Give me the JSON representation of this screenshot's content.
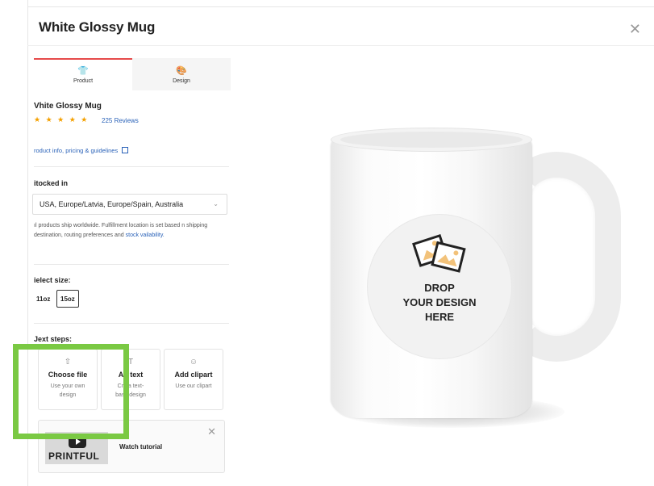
{
  "window": {
    "title": "White Glossy Mug"
  },
  "tabs": [
    {
      "label": "Product",
      "icon": "shirt-icon"
    },
    {
      "label": "Design",
      "icon": "palette-icon"
    }
  ],
  "product": {
    "name": "Vhite Glossy Mug",
    "stars": "★ ★ ★ ★ ★",
    "rating": 5,
    "reviews": "225 Reviews",
    "info_link": "roduct info, pricing & guidelines"
  },
  "stocked": {
    "label": "itocked in",
    "value": "USA, Europe/Latvia, Europe/Spain, Australia",
    "ship_text_prefix": "ıl products ship worldwide. Fulfillment location is set based n shipping destination, routing preferences and ",
    "ship_link": "stock vailability."
  },
  "size": {
    "label": "ielect size:",
    "options": [
      "11oz",
      "15oz"
    ],
    "selected": "15oz"
  },
  "next_steps": {
    "label": "Jext steps:",
    "cards": [
      {
        "icon": "upload-icon",
        "title": "Choose file",
        "subtitle": "Use your own design"
      },
      {
        "icon": "text-icon",
        "title": "Ad   text",
        "subtitle": "Cre  a text-\nbase  design"
      },
      {
        "icon": "smiley-icon",
        "title": "Add clipart",
        "subtitle": "Use our clipart"
      }
    ]
  },
  "tutorial": {
    "label": "Watch tutorial",
    "brand": "PRINTFUL"
  },
  "mockup": {
    "drop_text": "DROP\nYOUR DESIGN\nHERE"
  },
  "colors": {
    "accent_tab": "#e64a4a",
    "highlight": "#7ac943",
    "link": "#2a62b8",
    "star": "#f4a000"
  }
}
